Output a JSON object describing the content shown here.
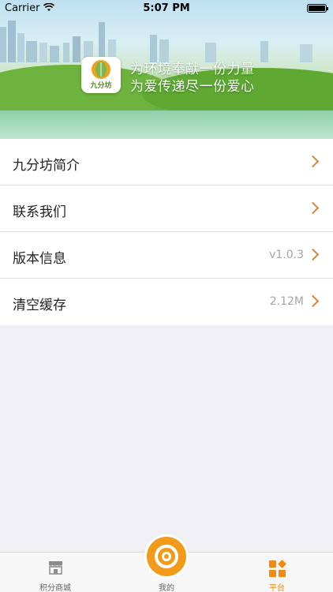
{
  "status_bar": {
    "carrier": "Carrier",
    "time": "5:07 PM"
  },
  "banner": {
    "logo_text": "九分坊",
    "slogan_line1": "为环境奉献一份力量",
    "slogan_line2": "为爱传递尽一份爱心"
  },
  "menu": [
    {
      "label": "九分坊简介",
      "value": ""
    },
    {
      "label": "联系我们",
      "value": ""
    },
    {
      "label": "版本信息",
      "value": "v1.0.3"
    },
    {
      "label": "清空缓存",
      "value": "2.12M"
    }
  ],
  "tabbar": {
    "mall": "积分商城",
    "mine": "我的",
    "platform": "平台",
    "active_color": "#f08a12"
  },
  "colors": {
    "accent": "#f29a1a",
    "chevron": "#d3863a"
  }
}
